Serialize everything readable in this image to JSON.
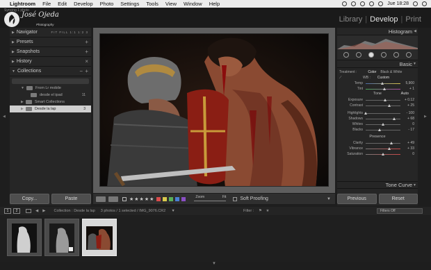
{
  "menubar": {
    "app": "Lightroom",
    "items": [
      "File",
      "Edit",
      "Develop",
      "Photo",
      "Settings",
      "Tools",
      "View",
      "Window",
      "Help"
    ],
    "clock": "Jue 18:28"
  },
  "identity": {
    "syncing": "Syncing 1 photo",
    "name": "José Ojeda",
    "subtitle": "Photography"
  },
  "modules": {
    "library": "Library",
    "develop": "Develop",
    "print": "Print",
    "separator": "|"
  },
  "left_panel": {
    "navigator": "Navigator",
    "nav_options": "FIT  FILL  1:1  1:2  3",
    "presets": "Presets",
    "snapshots": "Snapshots",
    "history": "History",
    "collections": "Collections",
    "collection_items": [
      {
        "label": "From Lr mobile",
        "count": ""
      },
      {
        "label": "desde el ipad",
        "count": "11"
      },
      {
        "label": "Smart Collections",
        "count": ""
      },
      {
        "label": "Desde la lap",
        "count": "3"
      }
    ],
    "copy_button": "Copy...",
    "paste_button": "Paste"
  },
  "toolbar": {
    "stars": "★★★★★",
    "label_colors": [
      "#d94c4c",
      "#d9c94c",
      "#58b05a",
      "#4a7fd4",
      "#8a4fc4"
    ],
    "zoom_label": "Zoom",
    "zoom_fit": "Fit",
    "soft_proofing": "Soft Proofing"
  },
  "right_panel": {
    "histogram": "Histogram",
    "basic": "Basic",
    "treatment_label": "Treatment :",
    "treatment_color": "Color",
    "treatment_bw": "Black & White",
    "wb_label": "WB :",
    "wb_value": "Custom",
    "temp_label": "Temp",
    "temp_value": "5,900",
    "tint_label": "Tint",
    "tint_value": "+ 1",
    "tone_label": "Tone",
    "tone_auto": "Auto",
    "exposure_label": "Exposure",
    "exposure_value": "+ 0.12",
    "contrast_label": "Contrast",
    "contrast_value": "+ 25",
    "highlights_label": "Highlights",
    "highlights_value": "- 100",
    "shadows_label": "Shadows",
    "shadows_value": "+ 68",
    "whites_label": "Whites",
    "whites_value": "0",
    "blacks_label": "Blacks",
    "blacks_value": "- 17",
    "presence_label": "Presence",
    "clarity_label": "Clarity",
    "clarity_value": "+ 49",
    "vibrance_label": "Vibrance",
    "vibrance_value": "+ 33",
    "saturation_label": "Saturation",
    "saturation_value": "0",
    "tone_curve": "Tone Curve",
    "previous_button": "Previous",
    "reset_button": "Reset"
  },
  "filmstrip_bar": {
    "page1": "1",
    "page2": "2",
    "collection_text": "Collection : Desde la lap",
    "photos_text": "3 photos / 1 selected / IMG_9076.CR2",
    "filter_label": "Filter :",
    "filter_value": "Filters Off"
  }
}
